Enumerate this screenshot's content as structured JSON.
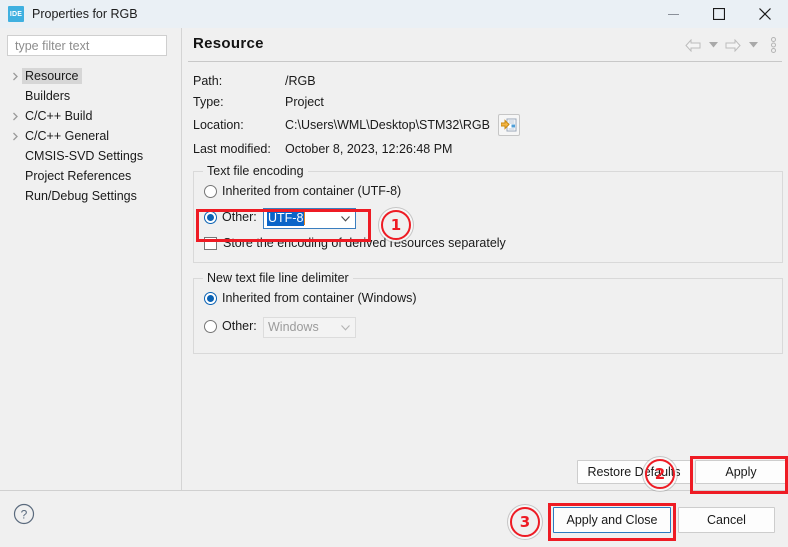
{
  "window": {
    "app_icon_text": "IDE",
    "title": "Properties for RGB",
    "minimize_icon": "minimize-icon",
    "maximize_icon": "maximize-icon",
    "close_icon": "close-icon"
  },
  "sidebar": {
    "filter": {
      "placeholder": "type filter text",
      "value": ""
    },
    "items": [
      {
        "label": "Resource",
        "expandable": true,
        "selected": true
      },
      {
        "label": "Builders",
        "expandable": false,
        "selected": false
      },
      {
        "label": "C/C++ Build",
        "expandable": true,
        "selected": false
      },
      {
        "label": "C/C++ General",
        "expandable": true,
        "selected": false
      },
      {
        "label": "CMSIS-SVD Settings",
        "expandable": false,
        "selected": false
      },
      {
        "label": "Project References",
        "expandable": false,
        "selected": false
      },
      {
        "label": "Run/Debug Settings",
        "expandable": false,
        "selected": false
      }
    ]
  },
  "page": {
    "title": "Resource",
    "toolbar": {
      "back_icon": "back-arrow-icon",
      "back_dropdown_icon": "chevron-down-icon",
      "forward_icon": "forward-arrow-icon",
      "forward_dropdown_icon": "chevron-down-icon",
      "menu_icon": "vertical-dots-icon"
    },
    "fields": [
      {
        "label": "Path:",
        "value": "/RGB"
      },
      {
        "label": "Type:",
        "value": "Project"
      },
      {
        "label": "Location:",
        "value": "C:\\Users\\WML\\Desktop\\STM32\\RGB"
      },
      {
        "label": "Last modified:",
        "value": "October 8, 2023, 12:26:48 PM"
      }
    ],
    "location_button_icon": "open-folder-icon",
    "encoding_group": {
      "legend": "Text file encoding",
      "inherited_label": "Inherited from container (UTF-8)",
      "inherited_selected": false,
      "other_label": "Other:",
      "other_selected": true,
      "other_value": "UTF-8",
      "store_derived_label": "Store the encoding of derived resources separately",
      "store_derived_checked": false
    },
    "delimiter_group": {
      "legend": "New text file line delimiter",
      "inherited_label": "Inherited from container (Windows)",
      "inherited_selected": true,
      "other_label": "Other:",
      "other_selected": false,
      "other_value": "Windows"
    },
    "restore_defaults_label": "Restore Defaults",
    "apply_label": "Apply"
  },
  "footer": {
    "help_icon": "help-question-icon",
    "apply_and_close_label": "Apply and Close",
    "cancel_label": "Cancel"
  },
  "annotations": {
    "accent_color": "#ee1b24",
    "markers": [
      {
        "id": "1",
        "label": "①",
        "digit": "1"
      },
      {
        "id": "2",
        "label": "②",
        "digit": "2"
      },
      {
        "id": "3",
        "label": "③",
        "digit": "3"
      }
    ]
  }
}
